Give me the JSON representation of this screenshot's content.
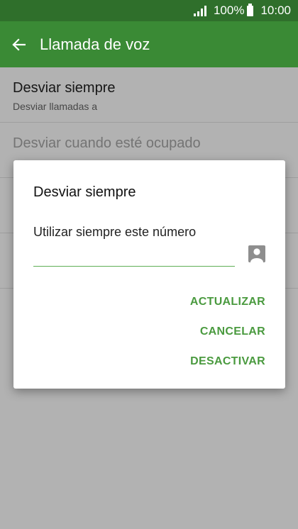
{
  "status_bar": {
    "battery_text": "100%",
    "time": "10:00"
  },
  "app_bar": {
    "title": "Llamada de voz"
  },
  "list": {
    "items": [
      {
        "primary": "Desviar siempre",
        "secondary": "Desviar llamadas a"
      },
      {
        "primary": "Desviar cuando esté ocupado",
        "secondary": ""
      },
      {
        "primary": "",
        "secondary": ""
      },
      {
        "primary": "",
        "secondary": ""
      }
    ]
  },
  "dialog": {
    "title": "Desviar siempre",
    "field_label": "Utilizar siempre este número",
    "field_value": "",
    "actions": {
      "update": "ACTUALIZAR",
      "cancel": "CANCELAR",
      "disable": "DESACTIVAR"
    }
  },
  "colors": {
    "status_bar": "#2f6f2b",
    "app_bar": "#3a8a35",
    "accent": "#4a9a3f"
  }
}
